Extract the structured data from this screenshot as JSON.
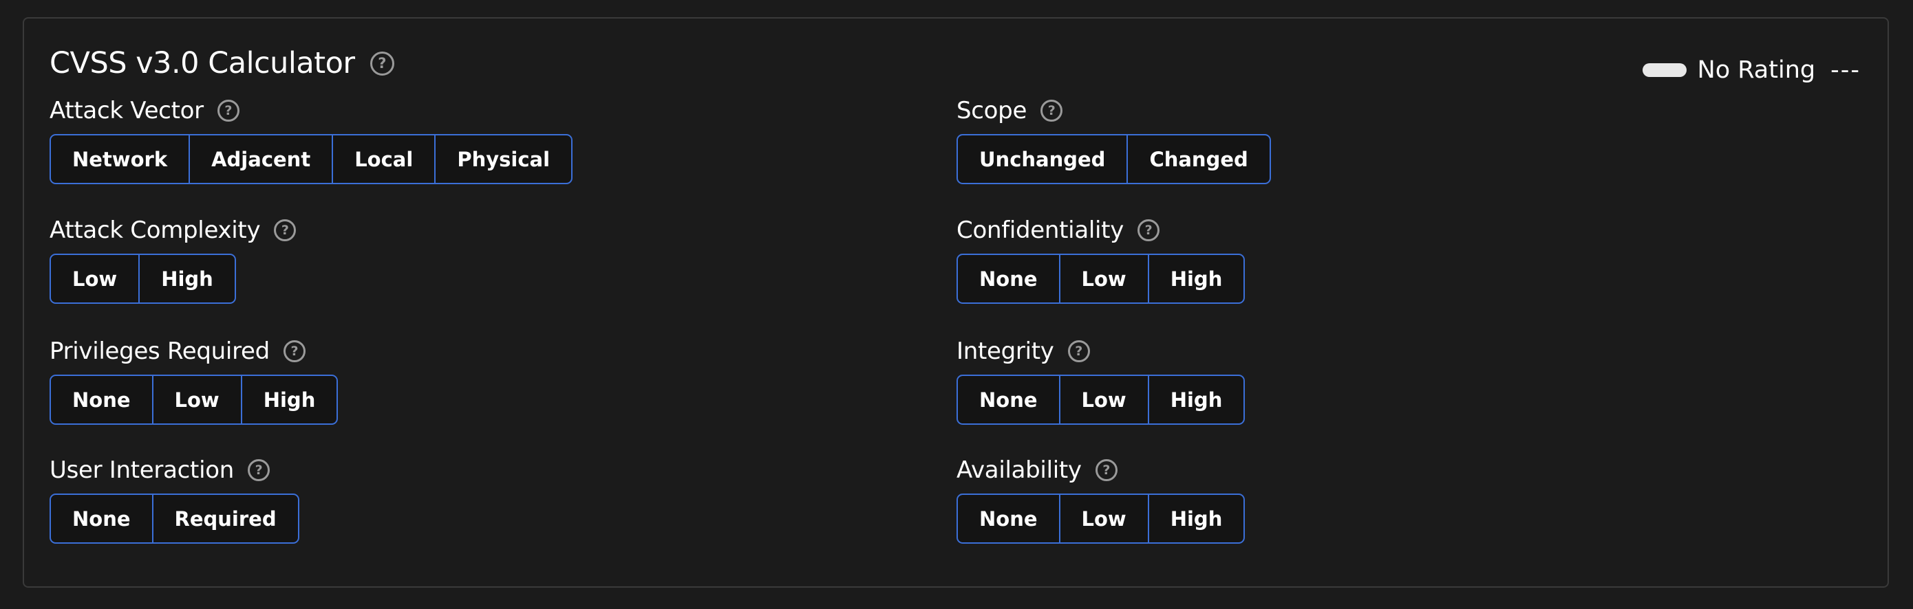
{
  "title": "CVSS v3.0 Calculator",
  "help_icon": "question-circle-icon",
  "rating": {
    "label": "No Rating",
    "score": "---",
    "indicator_color": "#e8e8e8"
  },
  "colors": {
    "background": "#1b1b1b",
    "accent_border": "#3b6fd8",
    "help_icon": "#9a9a9a"
  },
  "metrics": {
    "attack_vector": {
      "label": "Attack Vector",
      "options": [
        "Network",
        "Adjacent",
        "Local",
        "Physical"
      ]
    },
    "attack_complexity": {
      "label": "Attack Complexity",
      "options": [
        "Low",
        "High"
      ]
    },
    "privileges_required": {
      "label": "Privileges Required",
      "options": [
        "None",
        "Low",
        "High"
      ]
    },
    "user_interaction": {
      "label": "User Interaction",
      "options": [
        "None",
        "Required"
      ]
    },
    "scope": {
      "label": "Scope",
      "options": [
        "Unchanged",
        "Changed"
      ]
    },
    "confidentiality": {
      "label": "Confidentiality",
      "options": [
        "None",
        "Low",
        "High"
      ]
    },
    "integrity": {
      "label": "Integrity",
      "options": [
        "None",
        "Low",
        "High"
      ]
    },
    "availability": {
      "label": "Availability",
      "options": [
        "None",
        "Low",
        "High"
      ]
    }
  }
}
